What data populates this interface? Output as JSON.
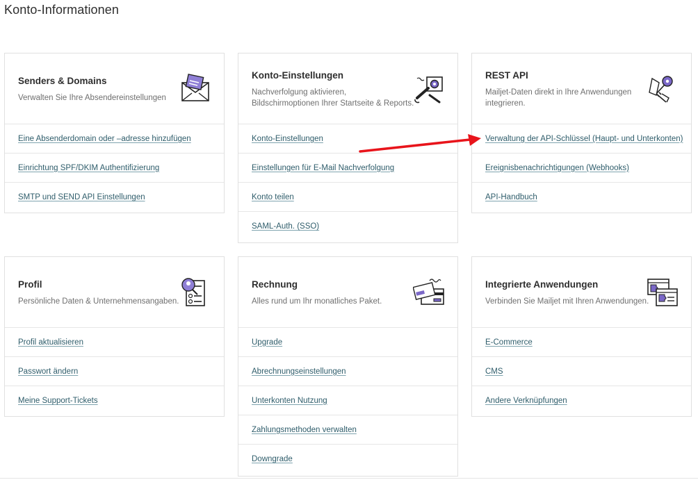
{
  "page": {
    "title": "Konto-Informationen"
  },
  "cards": {
    "senders": {
      "title": "Senders & Domains",
      "description": "Verwalten Sie Ihre Absendereinstellungen",
      "icon": "envelope-icon",
      "links": [
        "Eine Absenderdomain oder –adresse hinzufügen",
        "Einrichtung SPF/DKIM Authentifizierung",
        "SMTP und SEND API Einstellungen"
      ]
    },
    "account_settings": {
      "title": "Konto-Einstellungen",
      "description": "Nachverfolgung aktivieren, Bildschirmoptionen Ihrer Startseite & Reports.",
      "icon": "wrench-gear-icon",
      "links": [
        "Konto-Einstellungen",
        "Einstellungen für E-Mail Nachverfolgung",
        "Konto teilen",
        "SAML-Auth. (SSO)"
      ]
    },
    "rest_api": {
      "title": "REST API",
      "description": "Mailjet-Daten direkt in Ihre Anwendungen integrieren.",
      "icon": "keys-icon",
      "links": [
        "Verwaltung der API-Schlüssel (Haupt- und Unterkonten)",
        "Ereignisbenachrichtigungen (Webhooks)",
        "API-Handbuch"
      ]
    },
    "profile": {
      "title": "Profil",
      "description": "Persönliche Daten & Unternehmensangaben.",
      "icon": "profile-search-icon",
      "links": [
        "Profil aktualisieren",
        "Passwort ändern",
        "Meine Support-Tickets"
      ]
    },
    "billing": {
      "title": "Rechnung",
      "description": "Alles rund um Ihr monatliches Paket.",
      "icon": "credit-card-icon",
      "links": [
        "Upgrade",
        "Abrechnungseinstellungen",
        "Unterkonten Nutzung",
        "Zahlungsmethoden verwalten",
        "Downgrade"
      ]
    },
    "integrations": {
      "title": "Integrierte Anwendungen",
      "description": "Verbinden Sie Mailjet mit Ihren Anwendungen.",
      "icon": "puzzle-windows-icon",
      "links": [
        "E-Commerce",
        "CMS",
        "Andere Verknüpfungen"
      ]
    }
  },
  "colors": {
    "accent_purple": "#7b68c8",
    "link": "#2f5d6b",
    "annotation_arrow": "#e8141b"
  }
}
